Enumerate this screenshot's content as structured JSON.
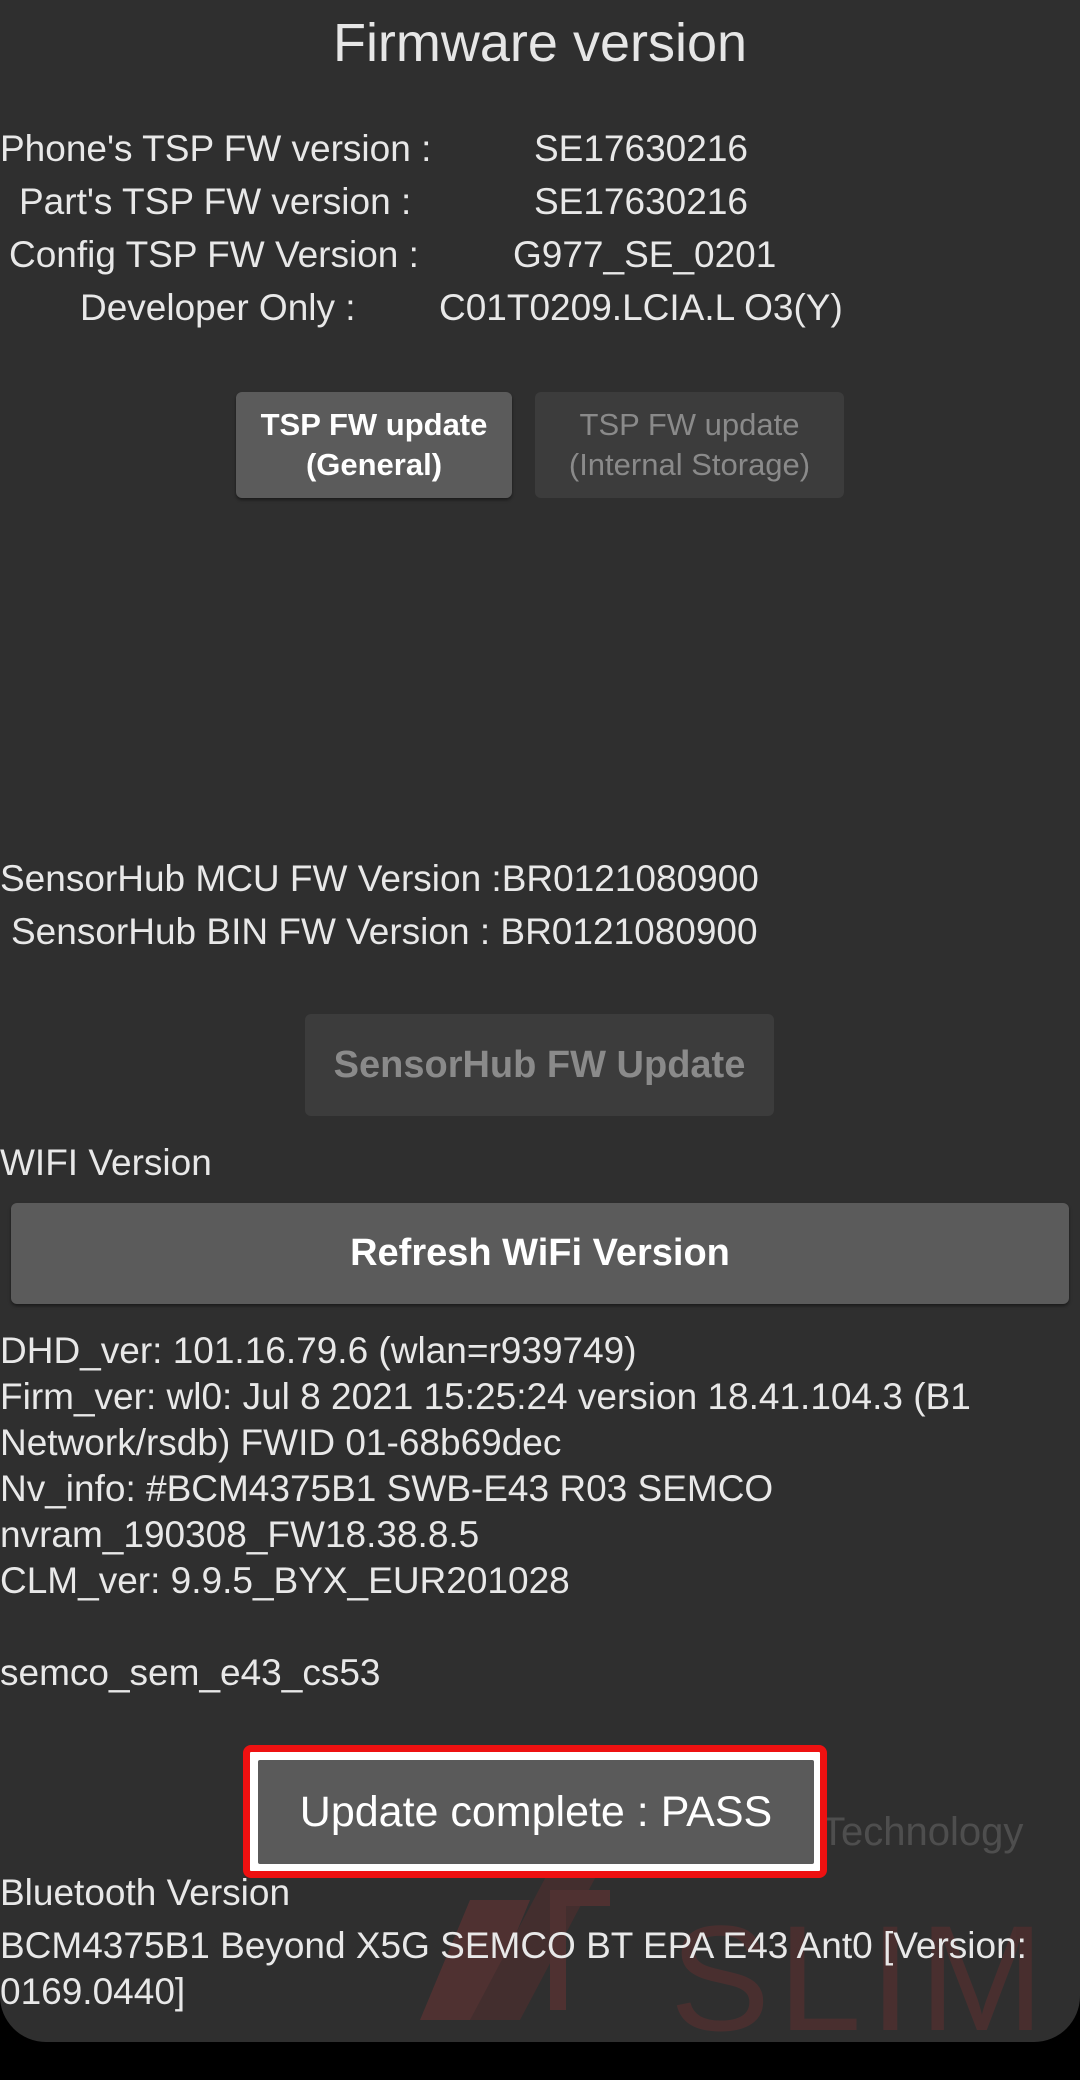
{
  "title": "Firmware version",
  "tsp": {
    "rows": [
      {
        "label": "Phone's TSP FW version :",
        "value": "SE17630216"
      },
      {
        "label": "Part's TSP FW version :",
        "value": "SE17630216"
      },
      {
        "label": "Config TSP FW Version :",
        "value": "G977_SE_0201"
      },
      {
        "label": "Developer Only :",
        "value": "C01T0209.LCIA.L O3(Y)"
      }
    ],
    "update_general": {
      "line1": "TSP FW update",
      "line2": "(General)"
    },
    "update_internal": {
      "line1": "TSP FW update",
      "line2": "(Internal Storage)"
    }
  },
  "sensorhub": {
    "mcu": "SensorHub MCU FW Version :BR0121080900",
    "bin": "SensorHub BIN FW Version : BR0121080900",
    "update_button": "SensorHub FW Update"
  },
  "wifi": {
    "heading": "WIFI Version",
    "refresh_button": "Refresh WiFi Version",
    "lines": [
      "DHD_ver: 101.16.79.6 (wlan=r939749)",
      "Firm_ver: wl0: Jul  8 2021 15:25:24 version 18.41.104.3 (B1",
      "Network/rsdb) FWID 01-68b69dec",
      "Nv_info: #BCM4375B1 SWB-E43 R03 SEMCO",
      "nvram_190308_FW18.38.8.5",
      "CLM_ver: 9.9.5_BYX_EUR201028",
      "",
      "semco_sem_e43_cs53"
    ]
  },
  "status_button": "Update complete : PASS",
  "bluetooth": {
    "heading": "Bluetooth Version",
    "lines": [
      "BCM4375B1 Beyond X5G SEMCO BT EPA E43 Ant0 [Version:",
      "0169.0440]"
    ]
  },
  "watermark": {
    "tagline": "Internet Technology",
    "brand": "SLIM"
  },
  "colors": {
    "highlight": "#ee1111",
    "button": "#5b5b5b",
    "background": "#2f2f2f"
  }
}
